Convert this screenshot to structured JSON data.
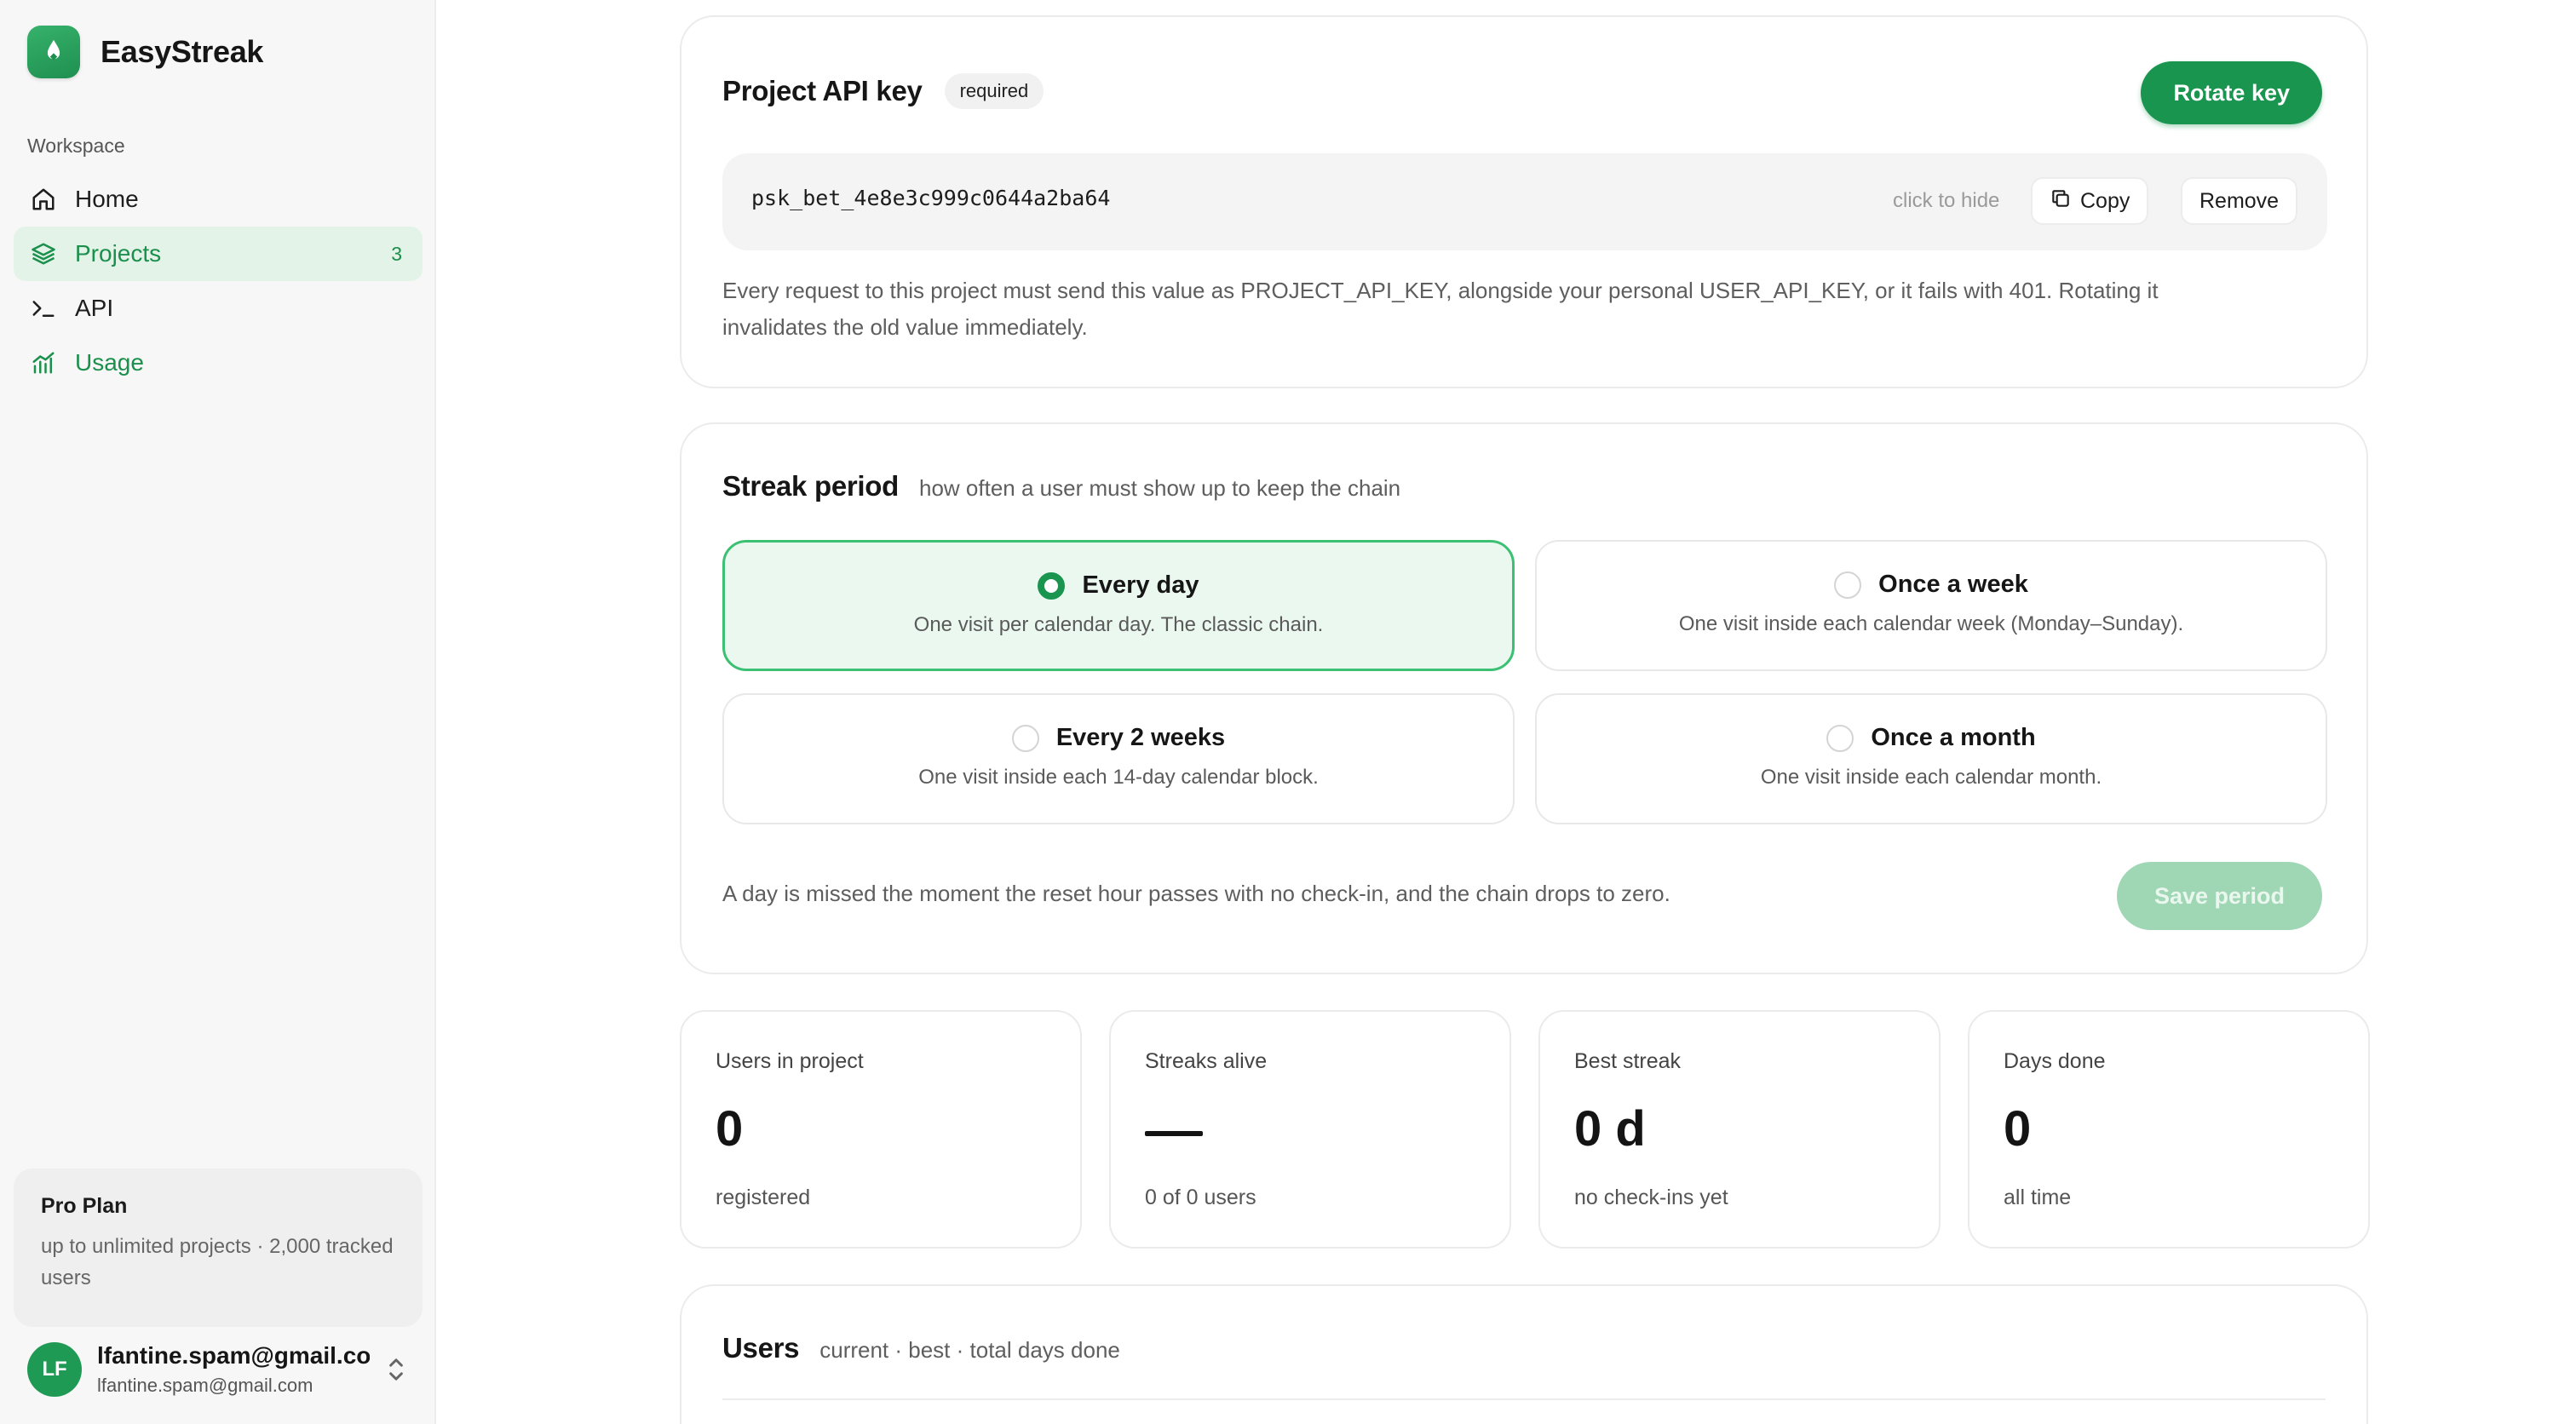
{
  "app": {
    "name": "EasyStreak"
  },
  "sidebar": {
    "section_label": "Workspace",
    "items": [
      {
        "label": "Home",
        "icon": "home-icon"
      },
      {
        "label": "Projects",
        "icon": "layers-icon",
        "count": "3",
        "active": true
      },
      {
        "label": "API",
        "icon": "terminal-icon"
      },
      {
        "label": "Usage",
        "icon": "chart-icon"
      }
    ],
    "plan": {
      "title": "Pro Plan",
      "description": "up to unlimited projects · 2,000 tracked users"
    },
    "user": {
      "initials": "LF",
      "name": "lfantine.spam@gmail.com",
      "email": "lfantine.spam@gmail.com"
    }
  },
  "api_key_card": {
    "title": "Project API key",
    "badge": "required",
    "rotate_label": "Rotate key",
    "key_value": "psk_bet_4e8e3c999c0644a2ba64",
    "hide_hint": "click to hide",
    "copy_label": "Copy",
    "remove_label": "Remove",
    "description": "Every request to this project must send this value as PROJECT_API_KEY, alongside your personal USER_API_KEY, or it fails with 401. Rotating it invalidates the old value immediately."
  },
  "streak_period": {
    "title": "Streak period",
    "subtitle": "how often a user must show up to keep the chain",
    "options": [
      {
        "title": "Every day",
        "description": "One visit per calendar day. The classic chain.",
        "selected": true
      },
      {
        "title": "Once a week",
        "description": "One visit inside each calendar week (Monday–Sunday).",
        "selected": false
      },
      {
        "title": "Every 2 weeks",
        "description": "One visit inside each 14-day calendar block.",
        "selected": false
      },
      {
        "title": "Once a month",
        "description": "One visit inside each calendar month.",
        "selected": false
      }
    ],
    "note": "A day is missed the moment the reset hour passes with no check-in, and the chain drops to zero.",
    "save_label": "Save period"
  },
  "stats": [
    {
      "label": "Users in project",
      "value": "0",
      "sub": "registered"
    },
    {
      "label": "Streaks alive",
      "value": "—",
      "sub": "0 of 0 users"
    },
    {
      "label": "Best streak",
      "value": "0 d",
      "sub": "no check-ins yet"
    },
    {
      "label": "Days done",
      "value": "0",
      "sub": "all time"
    }
  ],
  "users_card": {
    "title": "Users",
    "subtitle": "current · best · total days done"
  },
  "colors": {
    "accent": "#1a9550",
    "accent_light": "#ebf8f0",
    "accent_border": "#3cc073",
    "disabled_button": "#9fd6b4"
  }
}
